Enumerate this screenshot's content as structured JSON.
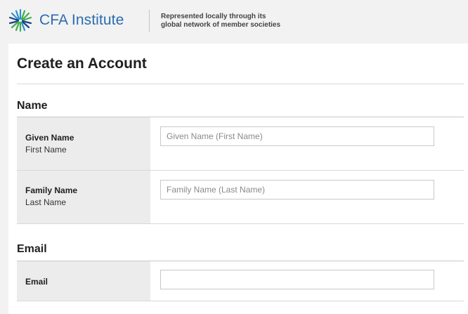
{
  "header": {
    "brand": "CFA Institute",
    "tagline": "Represented locally through its\nglobal network of member societies",
    "logo_icon": "cfa-logo-icon",
    "brand_color": "#2b6cb0",
    "logo_color": "#3fae49"
  },
  "page": {
    "title": "Create an Account"
  },
  "sections": {
    "name": {
      "title": "Name",
      "given": {
        "label": "Given Name",
        "sublabel": "First Name",
        "placeholder": "Given Name (First Name)",
        "value": ""
      },
      "family": {
        "label": "Family Name",
        "sublabel": "Last Name",
        "placeholder": "Family Name (Last Name)",
        "value": ""
      }
    },
    "email": {
      "title": "Email",
      "field": {
        "label": "Email",
        "placeholder": "",
        "value": ""
      }
    }
  }
}
